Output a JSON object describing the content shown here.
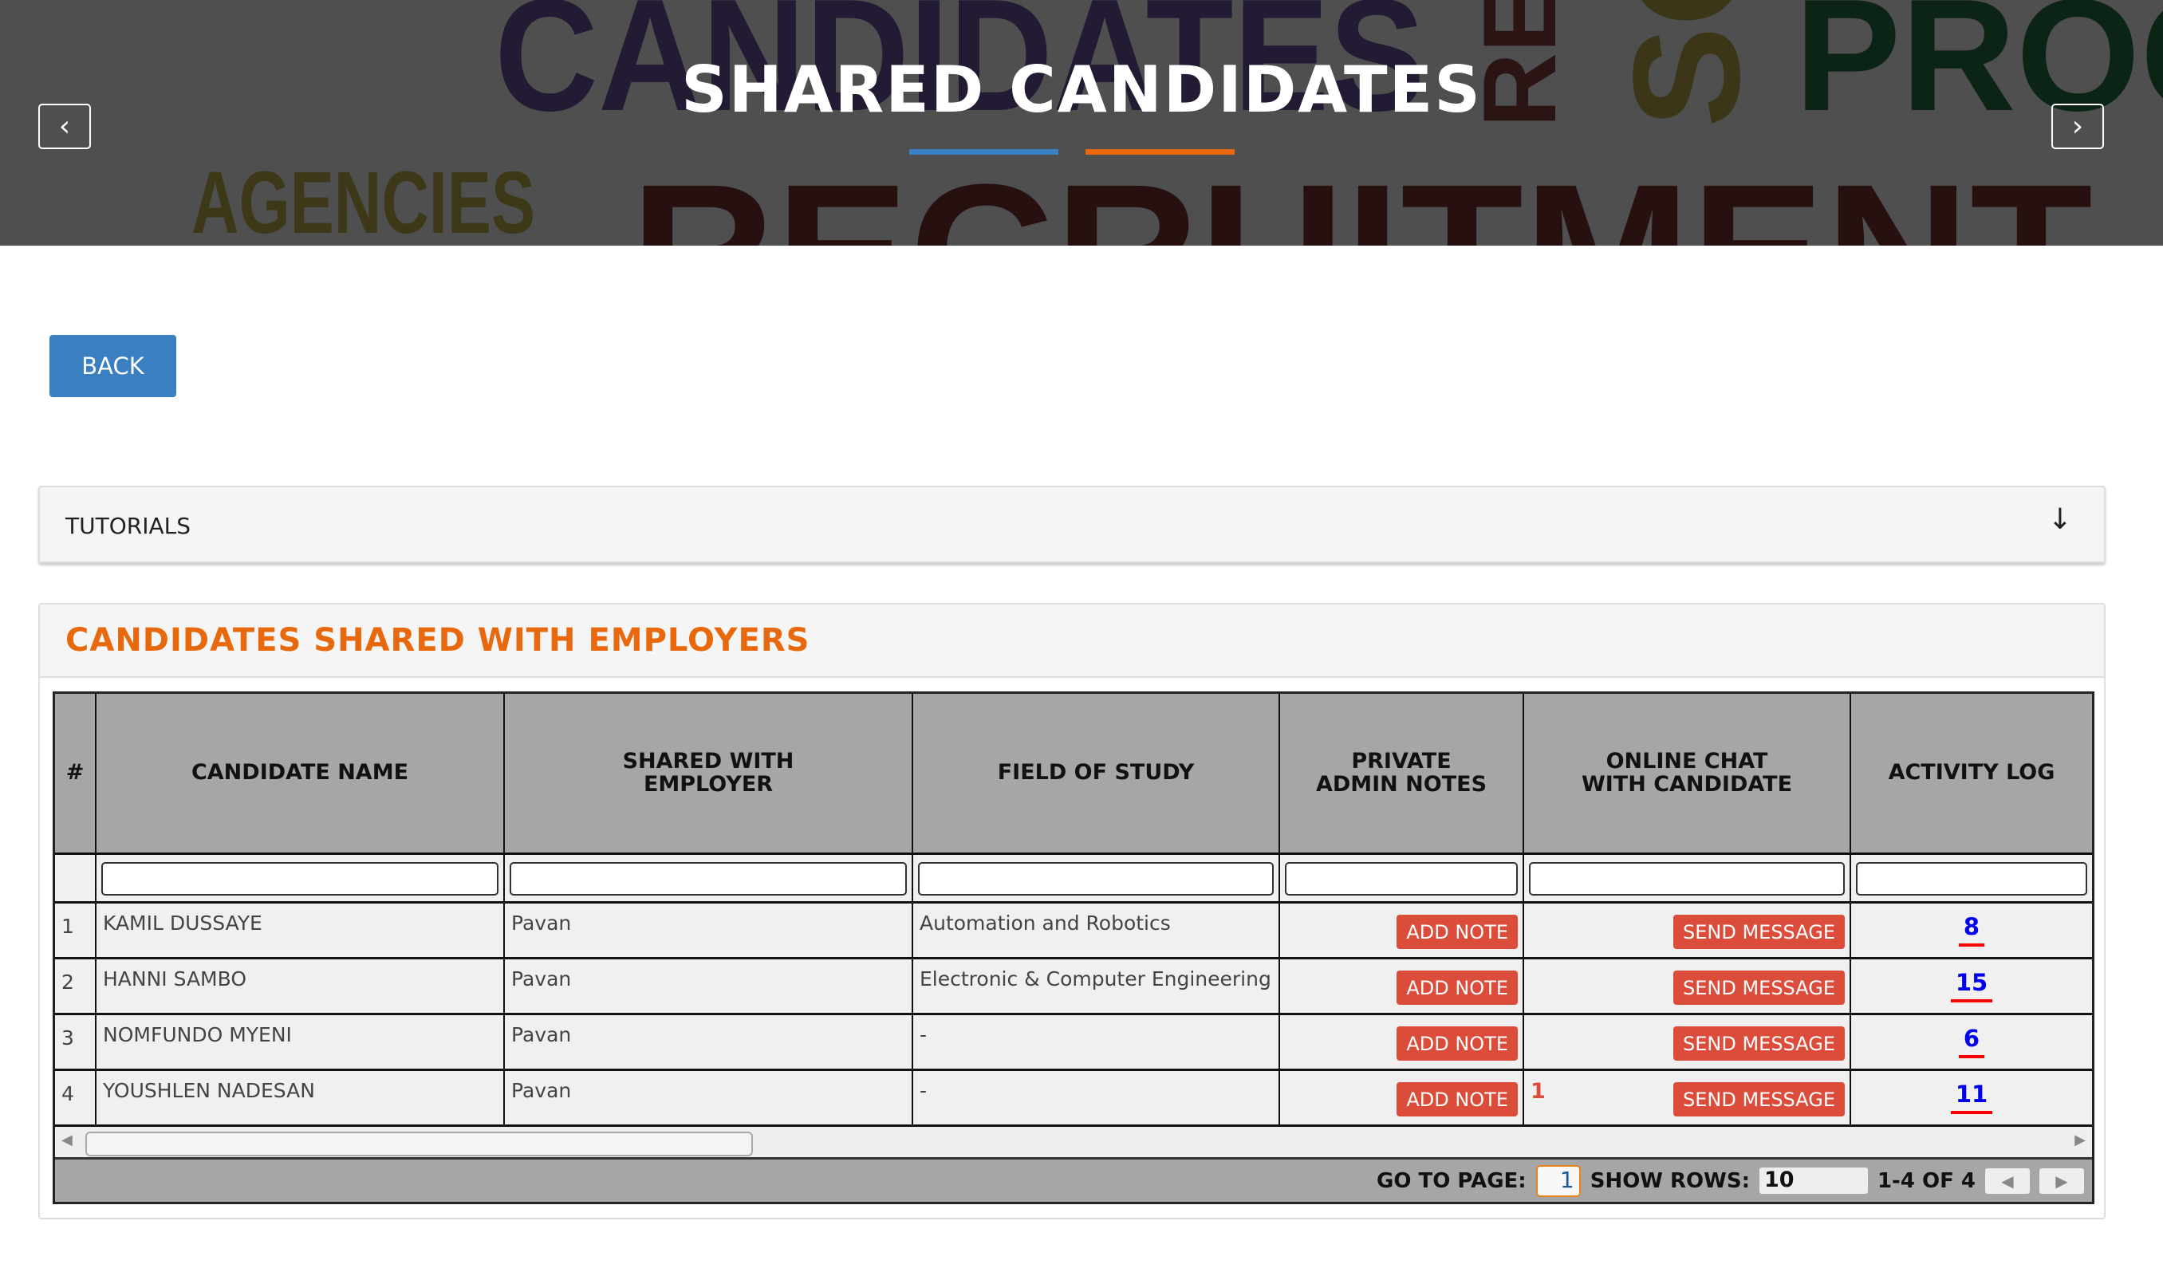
{
  "banner": {
    "title": "SHARED CANDIDATES",
    "background_words": [
      "CANDIDATES",
      "RE",
      "SO",
      "PROC",
      "AGENCIES",
      "RECRUITMENT"
    ],
    "accent_blue": "#3a7fc1",
    "accent_orange": "#e8690d",
    "prev_icon": "chevron-left",
    "next_icon": "chevron-right"
  },
  "back_label": "BACK",
  "tutorials": {
    "label": "TUTORIALS",
    "icon": "arrow-down"
  },
  "section": {
    "title": "CANDIDATES SHARED WITH EMPLOYERS"
  },
  "table": {
    "headers": [
      "#",
      "CANDIDATE NAME",
      "SHARED WITH EMPLOYER",
      "FIELD OF STUDY",
      "PRIVATE ADMIN NOTES",
      "ONLINE CHAT WITH CANDIDATE",
      "ACTIVITY LOG"
    ],
    "rows": [
      {
        "n": "1",
        "name": "KAMIL DUSSAYE",
        "employer": "Pavan",
        "field": "Automation and Robotics",
        "note": "ADD NOTE",
        "unread": "",
        "chat": "SEND MESSAGE",
        "log": "8"
      },
      {
        "n": "2",
        "name": "HANNI SAMBO",
        "employer": "Pavan",
        "field": "Electronic & Computer Engineering",
        "note": "ADD NOTE",
        "unread": "",
        "chat": "SEND MESSAGE",
        "log": "15"
      },
      {
        "n": "3",
        "name": "NOMFUNDO MYENI",
        "employer": "Pavan",
        "field": "-",
        "note": "ADD NOTE",
        "unread": "",
        "chat": "SEND MESSAGE",
        "log": "6"
      },
      {
        "n": "4",
        "name": "YOUSHLEN NADESAN",
        "employer": "Pavan",
        "field": "-",
        "note": "ADD NOTE",
        "unread": "1",
        "chat": "SEND MESSAGE",
        "log": "11"
      }
    ]
  },
  "pager": {
    "goto_label": "GO TO PAGE:",
    "page": "1",
    "rows_label": "SHOW ROWS:",
    "rows": "10",
    "range": "1-4 OF 4"
  }
}
